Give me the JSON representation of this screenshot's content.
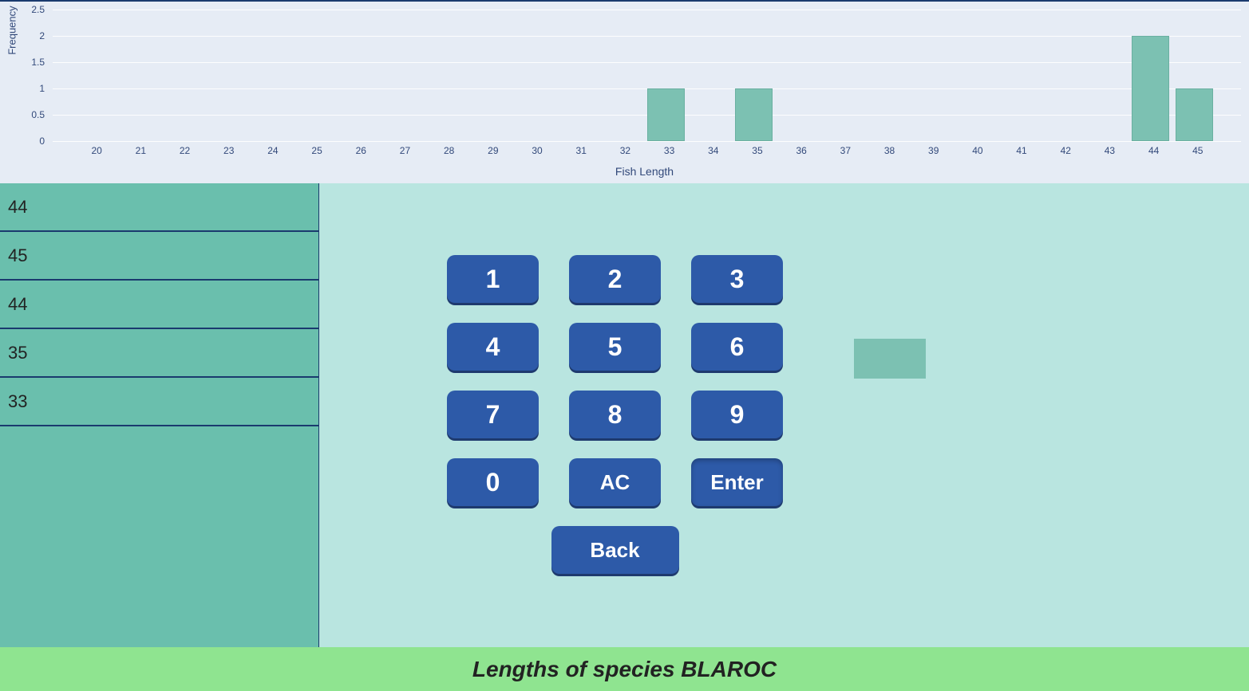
{
  "chart_data": {
    "type": "bar",
    "title": "",
    "xlabel": "Fish Length",
    "ylabel": "Frequency",
    "ylim": [
      0,
      2.5
    ],
    "y_ticks": [
      0,
      0.5,
      1,
      1.5,
      2,
      2.5
    ],
    "categories": [
      20,
      21,
      22,
      23,
      24,
      25,
      26,
      27,
      28,
      29,
      30,
      31,
      32,
      33,
      34,
      35,
      36,
      37,
      38,
      39,
      40,
      41,
      42,
      43,
      44,
      45
    ],
    "values": [
      0,
      0,
      0,
      0,
      0,
      0,
      0,
      0,
      0,
      0,
      0,
      0,
      0,
      1,
      0,
      1,
      0,
      0,
      0,
      0,
      0,
      0,
      0,
      0,
      2,
      1
    ]
  },
  "sidebar": {
    "items": [
      "44",
      "45",
      "44",
      "35",
      "33"
    ]
  },
  "keypad": {
    "k1": "1",
    "k2": "2",
    "k3": "3",
    "k4": "4",
    "k5": "5",
    "k6": "6",
    "k7": "7",
    "k8": "8",
    "k9": "9",
    "k0": "0",
    "ac": "AC",
    "enter": "Enter",
    "back": "Back"
  },
  "display_value": "",
  "footer": {
    "text": "Lengths of species BLAROC"
  }
}
